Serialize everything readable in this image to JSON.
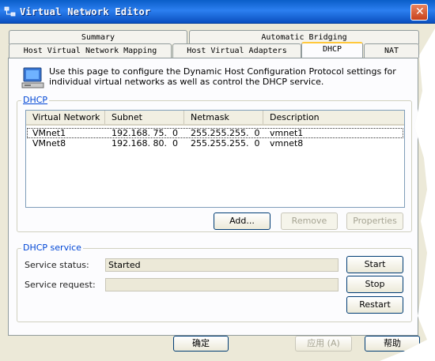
{
  "window": {
    "title": "Virtual Network Editor"
  },
  "tabs": [
    {
      "label": "Summary"
    },
    {
      "label": "Automatic Bridging"
    },
    {
      "label": "Host Virtual Network Mapping"
    },
    {
      "label": "Host Virtual Adapters"
    },
    {
      "label": "DHCP",
      "active": true
    },
    {
      "label": "NAT"
    }
  ],
  "info": {
    "text": "Use this page to configure the Dynamic Host Configuration Protocol settings for individual virtual networks as well as control the DHCP service."
  },
  "dhcp_group": {
    "label": "DHCP",
    "columns": [
      "Virtual Network",
      "Subnet",
      "Netmask",
      "Description"
    ],
    "rows": [
      {
        "network": "VMnet1",
        "subnet": "192.168. 75.  0",
        "netmask": "255.255.255.  0",
        "description": "vmnet1",
        "selected": true
      },
      {
        "network": "VMnet8",
        "subnet": "192.168. 80.  0",
        "netmask": "255.255.255.  0",
        "description": "vmnet8",
        "selected": false
      }
    ],
    "add_label": "Add...",
    "remove_label": "Remove",
    "properties_label": "Properties"
  },
  "service_group": {
    "label": "DHCP service",
    "status_label": "Service status:",
    "status_value": "Started",
    "request_label": "Service request:",
    "request_value": "",
    "start_label": "Start",
    "stop_label": "Stop",
    "restart_label": "Restart"
  },
  "footer": {
    "ok_label": "确定",
    "apply_label": "应用 (A)",
    "help_label": "帮助"
  },
  "colors": {
    "titlebar": "#0a5ec9",
    "group_label": "#0046d5",
    "tab_highlight": "#ffc83c"
  }
}
